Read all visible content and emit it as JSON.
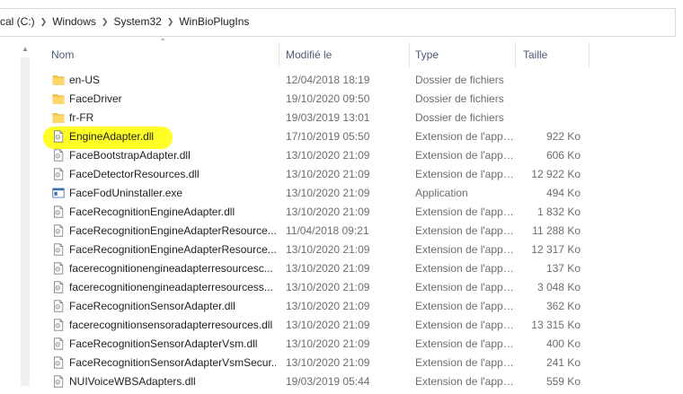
{
  "breadcrumb": [
    "cal (C:)",
    "Windows",
    "System32",
    "WinBioPlugIns"
  ],
  "columns": {
    "name": "Nom",
    "modified": "Modifié le",
    "type": "Type",
    "size": "Taille"
  },
  "files": [
    {
      "name": "en-US",
      "date": "12/04/2018 18:19",
      "type": "Dossier de fichiers",
      "size": "",
      "icon": "folder-icon"
    },
    {
      "name": "FaceDriver",
      "date": "19/10/2020 09:50",
      "type": "Dossier de fichiers",
      "size": "",
      "icon": "folder-icon"
    },
    {
      "name": "fr-FR",
      "date": "19/03/2019 13:01",
      "type": "Dossier de fichiers",
      "size": "",
      "icon": "folder-icon"
    },
    {
      "name": "EngineAdapter.dll",
      "date": "17/10/2019 05:50",
      "type": "Extension de l'app…",
      "size": "922 Ko",
      "icon": "dll-icon"
    },
    {
      "name": "FaceBootstrapAdapter.dll",
      "date": "13/10/2020 21:09",
      "type": "Extension de l'app…",
      "size": "606 Ko",
      "icon": "dll-icon"
    },
    {
      "name": "FaceDetectorResources.dll",
      "date": "13/10/2020 21:09",
      "type": "Extension de l'app…",
      "size": "12 922 Ko",
      "icon": "dll-icon"
    },
    {
      "name": "FaceFodUninstaller.exe",
      "date": "13/10/2020 21:09",
      "type": "Application",
      "size": "494 Ko",
      "icon": "exe-icon"
    },
    {
      "name": "FaceRecognitionEngineAdapter.dll",
      "date": "13/10/2020 21:09",
      "type": "Extension de l'app…",
      "size": "1 832 Ko",
      "icon": "dll-icon"
    },
    {
      "name": "FaceRecognitionEngineAdapterResource...",
      "date": "11/04/2018 09:21",
      "type": "Extension de l'app…",
      "size": "11 288 Ko",
      "icon": "dll-icon"
    },
    {
      "name": "FaceRecognitionEngineAdapterResource...",
      "date": "13/10/2020 21:09",
      "type": "Extension de l'app…",
      "size": "12 317 Ko",
      "icon": "dll-icon"
    },
    {
      "name": "facerecognitionengineadapterresourcesc...",
      "date": "13/10/2020 21:09",
      "type": "Extension de l'app…",
      "size": "137 Ko",
      "icon": "dll-icon"
    },
    {
      "name": "facerecognitionengineadapterresourcess...",
      "date": "13/10/2020 21:09",
      "type": "Extension de l'app…",
      "size": "3 048 Ko",
      "icon": "dll-icon"
    },
    {
      "name": "FaceRecognitionSensorAdapter.dll",
      "date": "13/10/2020 21:09",
      "type": "Extension de l'app…",
      "size": "362 Ko",
      "icon": "dll-icon"
    },
    {
      "name": "facerecognitionsensoradapterresources.dll",
      "date": "13/10/2020 21:09",
      "type": "Extension de l'app…",
      "size": "13 315 Ko",
      "icon": "dll-icon"
    },
    {
      "name": "FaceRecognitionSensorAdapterVsm.dll",
      "date": "13/10/2020 21:09",
      "type": "Extension de l'app…",
      "size": "400 Ko",
      "icon": "dll-icon"
    },
    {
      "name": "FaceRecognitionSensorAdapterVsmSecur...",
      "date": "13/10/2020 21:09",
      "type": "Extension de l'app…",
      "size": "241 Ko",
      "icon": "dll-icon"
    },
    {
      "name": "NUIVoiceWBSAdapters.dll",
      "date": "19/03/2019 05:44",
      "type": "Extension de l'app…",
      "size": "559 Ko",
      "icon": "dll-icon"
    }
  ],
  "colors": {
    "highlight": "#ffff00",
    "folder": "#f5c542",
    "header_text": "#4a5a78"
  }
}
